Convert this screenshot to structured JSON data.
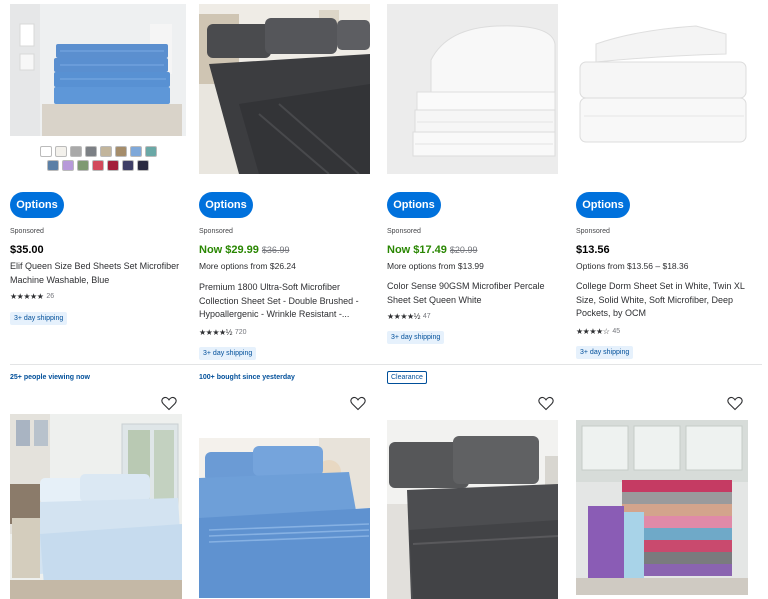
{
  "products": [
    {
      "options_label": "Options",
      "sponsored": "Sponsored",
      "price": "$35.00",
      "title": "Elif Queen Size Bed Sheets Set Microfiber Machine Washable, Blue",
      "review_count": "26",
      "shipping": "3+ day shipping",
      "swatch_colors_row1": [
        "#ffffff",
        "#f3f1ec",
        "#a9a9a9",
        "#7c8085",
        "#c2b59c",
        "#a58d6b",
        "#7fa8d9",
        "#6aa8a6"
      ],
      "swatch_colors_row2": [
        "#5b7fa6",
        "#b79ad9",
        "#7f9a72",
        "#d24a5b",
        "#a3203a",
        "#3e3e66",
        "#2a2a40"
      ]
    },
    {
      "options_label": "Options",
      "sponsored": "Sponsored",
      "price_now": "Now $29.99",
      "price_was": "$36.99",
      "more_options": "More options from $26.24",
      "title": "Premium 1800 Ultra-Soft Microfiber Collection Sheet Set - Double Brushed - Hypoallergenic - Wrinkle Resistant -...",
      "review_count": "720",
      "shipping": "3+ day shipping"
    },
    {
      "options_label": "Options",
      "sponsored": "Sponsored",
      "price_now": "Now $17.49",
      "price_was": "$20.99",
      "more_options": "More options from $13.99",
      "title": "Color Sense 90GSM Microfiber Percale Sheet Set Queen White",
      "review_count": "47",
      "shipping": "3+ day shipping"
    },
    {
      "options_label": "Options",
      "sponsored": "Sponsored",
      "price": "$13.56",
      "more_options": "Options from $13.56 – $18.36",
      "title": "College Dorm Sheet Set in White, Twin XL Size, Solid White, Soft Microfiber, Deep Pockets, by OCM",
      "review_count": "45",
      "shipping": "3+ day shipping"
    }
  ],
  "row2_tags": {
    "col1": "25+ people viewing now",
    "col2": "100+ bought since yesterday",
    "col3": "Clearance"
  },
  "icons": {
    "favorite": "heart-outline-icon",
    "star": "star-icon"
  },
  "colors": {
    "primary_button": "#0071dc",
    "sale_price": "#2a8703",
    "badge_bg": "#e6f1fc",
    "badge_text": "#004f9a"
  }
}
